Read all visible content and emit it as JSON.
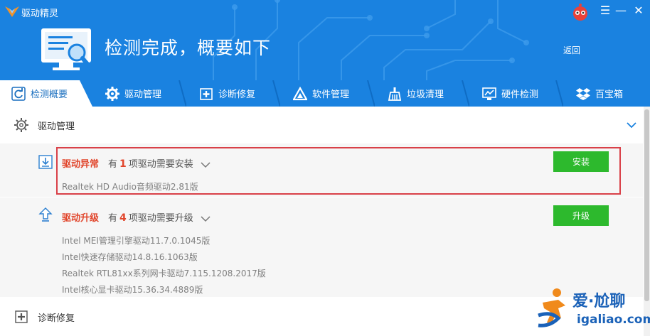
{
  "app": {
    "title": "驱动精灵"
  },
  "header": {
    "headline": "检测完成，概要如下",
    "back_label": "返回"
  },
  "tabs": [
    {
      "label": "检测概要",
      "icon": "refresh-icon",
      "active": true
    },
    {
      "label": "驱动管理",
      "icon": "gear-icon"
    },
    {
      "label": "诊断修复",
      "icon": "medical-cross-icon"
    },
    {
      "label": "软件管理",
      "icon": "triangle-logo-icon"
    },
    {
      "label": "垃圾清理",
      "icon": "broom-icon"
    },
    {
      "label": "硬件检测",
      "icon": "monitor-chart-icon"
    },
    {
      "label": "百宝箱",
      "icon": "dropbox-icon"
    }
  ],
  "sections": {
    "driver_management": {
      "title": "驱动管理"
    },
    "diagnose_repair": {
      "title": "诊断修复"
    }
  },
  "abnormal": {
    "title": "驱动异常",
    "desc_prefix": "有",
    "count": "1",
    "desc_suffix": "项驱动需要安装",
    "button_label": "安装",
    "drivers": [
      "Realtek HD Audio音频驱动2.81版"
    ]
  },
  "upgrade": {
    "title": "驱动升级",
    "desc_prefix": "有",
    "count": "4",
    "desc_suffix": "项驱动需要升级",
    "button_label": "升级",
    "drivers": [
      "Intel MEI管理引擎驱动11.7.0.1045版",
      "Intel快速存储驱动14.8.16.1063版",
      "Realtek RTL81xx系列网卡驱动7.115.1208.2017版",
      "Intel核心显卡驱动15.36.34.4889版"
    ]
  },
  "watermark": {
    "name": "爱·尬聊",
    "url": "igaliao.com"
  },
  "colors": {
    "brand_blue": "#1a82e0",
    "alert_red": "#e1462c",
    "button_green": "#2db92d",
    "highlight_red": "#d94048"
  }
}
